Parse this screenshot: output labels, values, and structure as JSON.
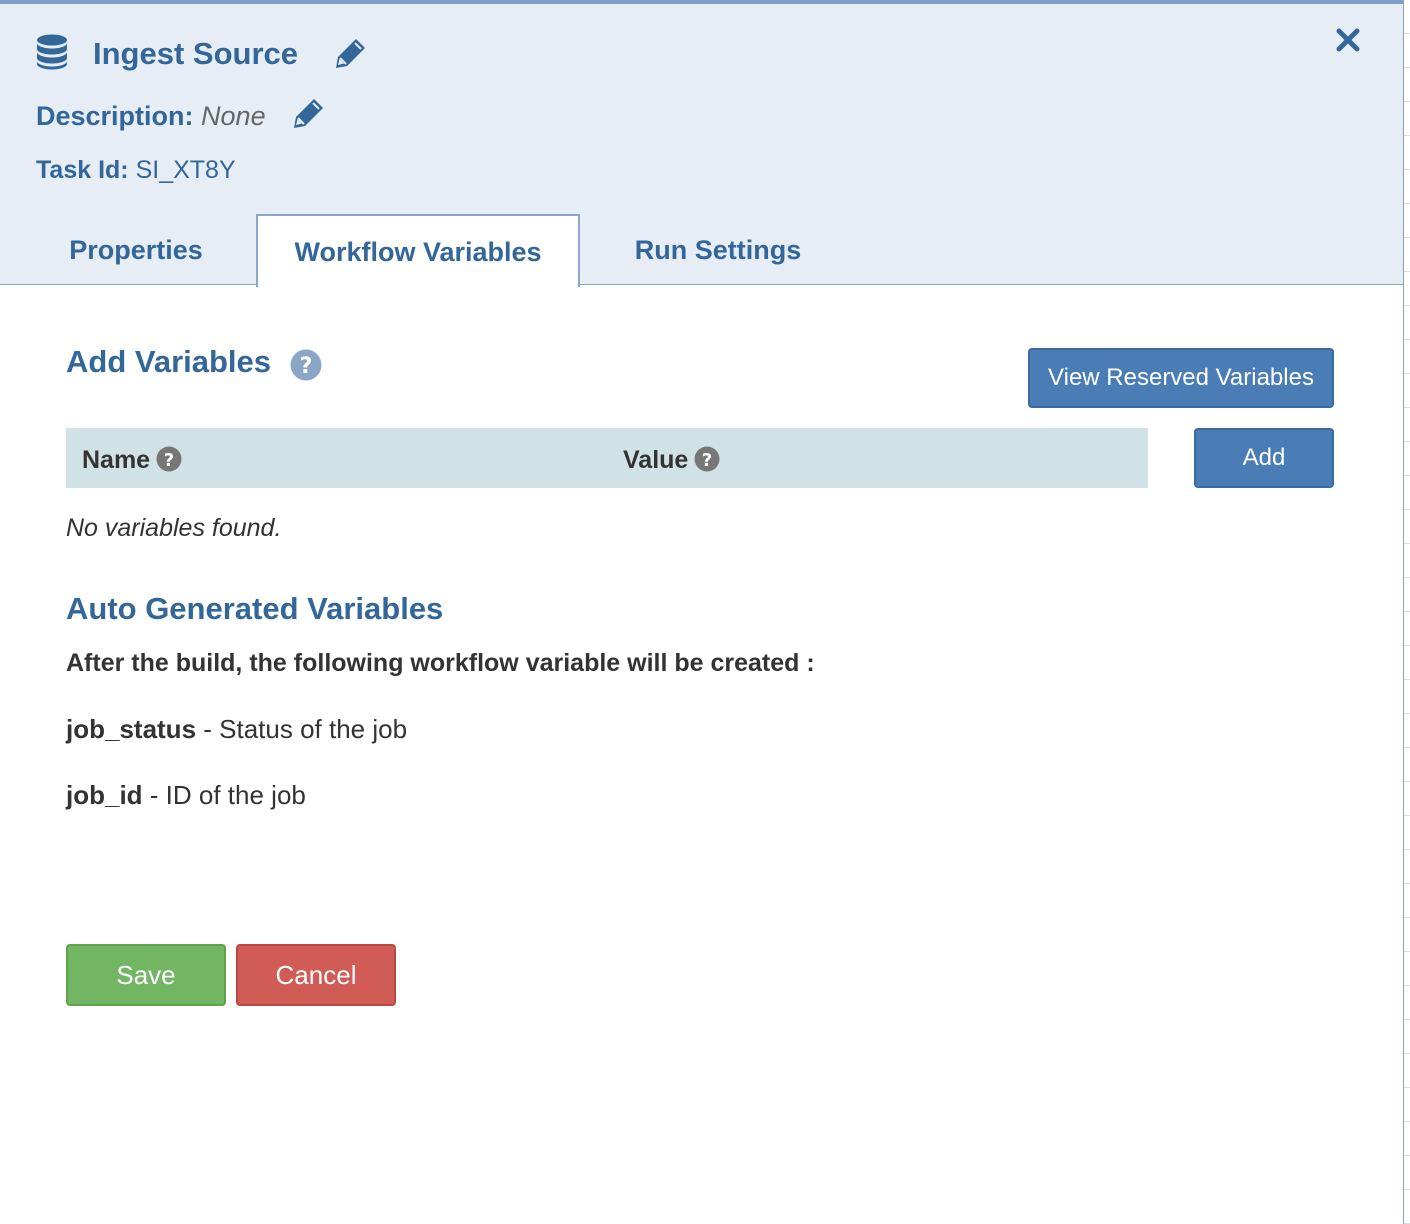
{
  "header": {
    "icon": "database-icon",
    "title": "Ingest Source",
    "description_label": "Description:",
    "description_value": "None",
    "task_id_label": "Task Id:",
    "task_id_value": "SI_XT8Y"
  },
  "tabs": [
    {
      "label": "Properties",
      "active": false
    },
    {
      "label": "Workflow Variables",
      "active": true
    },
    {
      "label": "Run Settings",
      "active": false
    }
  ],
  "add_variables": {
    "title": "Add Variables",
    "view_reserved_label": "View Reserved Variables",
    "add_label": "Add",
    "columns": [
      "Name",
      "Value"
    ],
    "empty_message": "No variables found."
  },
  "auto_generated": {
    "title": "Auto Generated Variables",
    "description": "After the build, the following workflow variable will be created :",
    "variables": [
      {
        "name": "job_status",
        "description": "Status of the job"
      },
      {
        "name": "job_id",
        "description": "ID of the job"
      }
    ]
  },
  "actions": {
    "save_label": "Save",
    "cancel_label": "Cancel"
  },
  "colors": {
    "accent": "#336699",
    "header_bg": "#e7edf5",
    "table_header_bg": "#d1e2e6",
    "primary_button": "#4a7db5",
    "save_button": "#72b563",
    "cancel_button": "#d15b55"
  }
}
